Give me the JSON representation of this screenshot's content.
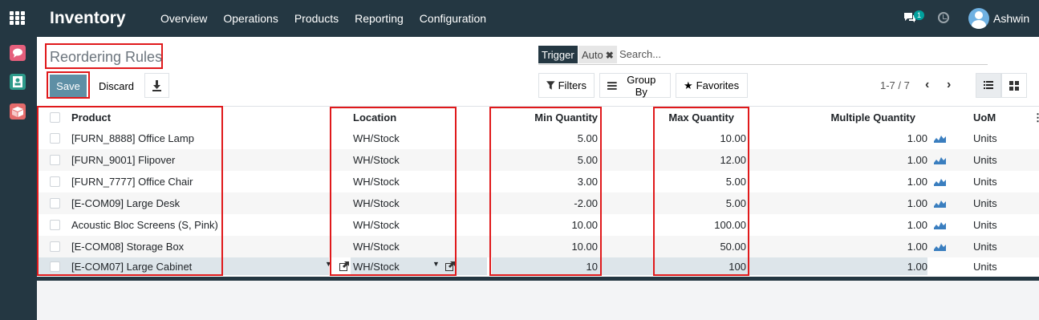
{
  "topbar": {
    "app_title": "Inventory",
    "menu": [
      "Overview",
      "Operations",
      "Products",
      "Reporting",
      "Configuration"
    ],
    "chat_badge": "1",
    "user_name": "Ashwin"
  },
  "page": {
    "title": "Reordering Rules",
    "save_label": "Save",
    "discard_label": "Discard"
  },
  "search": {
    "facet_label": "Trigger",
    "facet_value": "Auto",
    "placeholder": "Search..."
  },
  "toolbar": {
    "filters_label": "Filters",
    "groupby_label": "Group By",
    "favorites_label": "Favorites",
    "pager": "1-7 / 7"
  },
  "table": {
    "headers": {
      "product": "Product",
      "location": "Location",
      "min_qty": "Min Quantity",
      "max_qty": "Max Quantity",
      "multiple_qty": "Multiple Quantity",
      "uom": "UoM"
    },
    "rows": [
      {
        "product": "[FURN_8888] Office Lamp",
        "location": "WH/Stock",
        "min": "5.00",
        "max": "10.00",
        "multiple": "1.00",
        "uom": "Units"
      },
      {
        "product": "[FURN_9001] Flipover",
        "location": "WH/Stock",
        "min": "5.00",
        "max": "12.00",
        "multiple": "1.00",
        "uom": "Units"
      },
      {
        "product": "[FURN_7777] Office Chair",
        "location": "WH/Stock",
        "min": "3.00",
        "max": "5.00",
        "multiple": "1.00",
        "uom": "Units"
      },
      {
        "product": "[E-COM09] Large Desk",
        "location": "WH/Stock",
        "min": "-2.00",
        "max": "5.00",
        "multiple": "1.00",
        "uom": "Units"
      },
      {
        "product": "Acoustic Bloc Screens (S, Pink)",
        "location": "WH/Stock",
        "min": "10.00",
        "max": "100.00",
        "multiple": "1.00",
        "uom": "Units"
      },
      {
        "product": "[E-COM08] Storage Box",
        "location": "WH/Stock",
        "min": "10.00",
        "max": "50.00",
        "multiple": "1.00",
        "uom": "Units"
      }
    ],
    "edit_row": {
      "product": "[E-COM07] Large Cabinet",
      "location": "WH/Stock",
      "min": "10",
      "max": "100",
      "multiple": "1.00",
      "uom": "Units"
    }
  },
  "icons": {
    "apps": "apps-grid-icon",
    "chat": "chat-icon",
    "clock": "clock-icon",
    "download": "download-icon",
    "filter": "filter-icon",
    "groupby": "list-icon",
    "favorites": "star-icon",
    "forecast": "bar-chart-icon",
    "external": "external-link-icon"
  },
  "colors": {
    "topbar": "#243742",
    "save_button": "#5e8fa5",
    "highlight": "#e0191b",
    "forecast_icon": "#3a7ebf"
  }
}
